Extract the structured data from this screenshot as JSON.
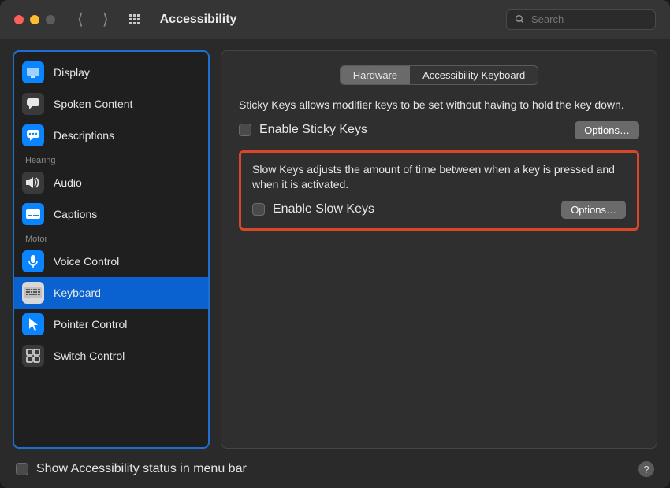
{
  "window": {
    "title": "Accessibility"
  },
  "search": {
    "placeholder": "Search"
  },
  "sidebar": {
    "sections": [
      {
        "label": "",
        "items": [
          {
            "id": "display",
            "label": "Display"
          },
          {
            "id": "spoken-content",
            "label": "Spoken Content"
          },
          {
            "id": "descriptions",
            "label": "Descriptions"
          }
        ]
      },
      {
        "label": "Hearing",
        "items": [
          {
            "id": "audio",
            "label": "Audio"
          },
          {
            "id": "captions",
            "label": "Captions"
          }
        ]
      },
      {
        "label": "Motor",
        "items": [
          {
            "id": "voice-control",
            "label": "Voice Control"
          },
          {
            "id": "keyboard",
            "label": "Keyboard",
            "selected": true
          },
          {
            "id": "pointer-control",
            "label": "Pointer Control"
          },
          {
            "id": "switch-control",
            "label": "Switch Control"
          }
        ]
      }
    ]
  },
  "tabs": {
    "hardware": "Hardware",
    "accessibility_keyboard": "Accessibility Keyboard",
    "active": "hardware"
  },
  "sticky": {
    "desc": "Sticky Keys allows modifier keys to be set without having to hold the key down.",
    "checkbox_label": "Enable Sticky Keys",
    "options_label": "Options…"
  },
  "slow": {
    "desc": "Slow Keys adjusts the amount of time between when a key is pressed and when it is activated.",
    "checkbox_label": "Enable Slow Keys",
    "options_label": "Options…"
  },
  "footer": {
    "show_status_label": "Show Accessibility status in menu bar",
    "help": "?"
  }
}
